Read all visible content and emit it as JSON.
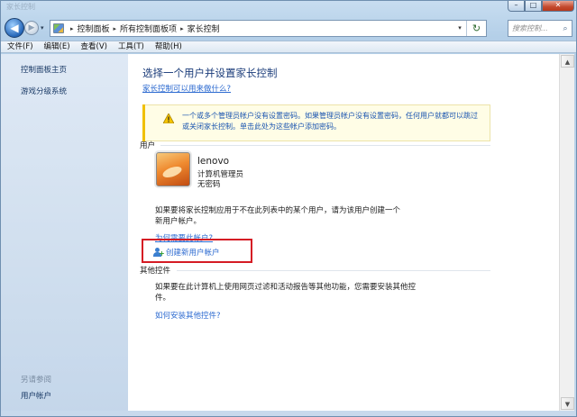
{
  "window": {
    "title_ghost": "家长控制",
    "min_glyph": "–",
    "max_glyph": "□",
    "close_glyph": "✕"
  },
  "nav": {
    "back_glyph": "◀",
    "forward_glyph": "▶",
    "history_glyph": "▾"
  },
  "address": {
    "icon": "control-panel-icon",
    "separator": "▸",
    "crumbs": [
      "控制面板",
      "所有控制面板项",
      "家长控制"
    ],
    "dropdown_glyph": "▾",
    "refresh_glyph": "↻"
  },
  "search": {
    "placeholder": "搜索控制...",
    "icon_glyph": "⌕"
  },
  "menu": [
    "文件(F)",
    "编辑(E)",
    "查看(V)",
    "工具(T)",
    "帮助(H)"
  ],
  "sidebar": {
    "links": [
      "控制面板主页",
      "游戏分级系统"
    ],
    "see_also": "另请参阅",
    "user_accounts": "用户帐户"
  },
  "main": {
    "help_glyph": "?",
    "title": "选择一个用户并设置家长控制",
    "parental_link": "家长控制可以用来做什么?",
    "warning_text": "一个或多个管理员帐户没有设置密码。如果管理员帐户没有设置密码，任何用户就都可以跳过或关闭家长控制。单击此处为这些帐户添加密码。",
    "users_section": "用户",
    "user": {
      "name": "lenovo",
      "role": "计算机管理员",
      "password": "无密码"
    },
    "info_text": "如果要将家长控制应用于不在此列表中的某个用户，请为该用户创建一个新用户帐户。",
    "why_link": "为何需要此帐户?",
    "create_account": "创建新用户帐户",
    "other_section": "其他控件",
    "other_text": "如果要在此计算机上使用网页过滤和活动报告等其他功能，您需要安装其他控件。",
    "other_link": "如何安装其他控件?"
  },
  "scrollbar": {
    "up_glyph": "▲",
    "down_glyph": "▼"
  },
  "colors": {
    "link": "#2c6ad0",
    "title": "#1b3c7a",
    "highlight_box": "#d51b24",
    "warning_bg": "#fffde6"
  }
}
